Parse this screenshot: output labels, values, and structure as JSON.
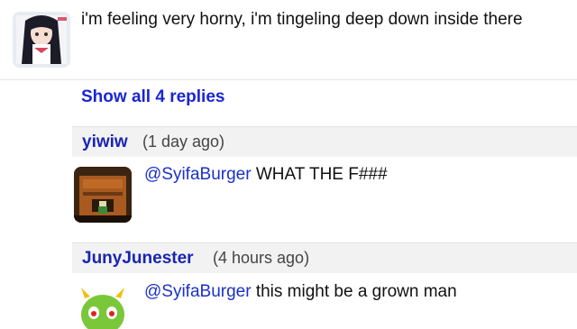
{
  "comments": {
    "top": {
      "text": "i'm feeling very horny, i'm tingeling deep down inside there"
    },
    "show_replies_label": "Show all 4 replies",
    "reply1": {
      "username": "yiwiw",
      "time": "(1 day ago)",
      "mention": "@SyifaBurger",
      "text": " WHAT THE F###"
    },
    "reply2": {
      "username": "JunyJunester",
      "time": "(4 hours ago)",
      "mention": "@SyifaBurger",
      "text": " this might be a grown man"
    }
  },
  "colors": {
    "link_blue": "#1a25d6",
    "header_bg": "#f2f2f2"
  }
}
